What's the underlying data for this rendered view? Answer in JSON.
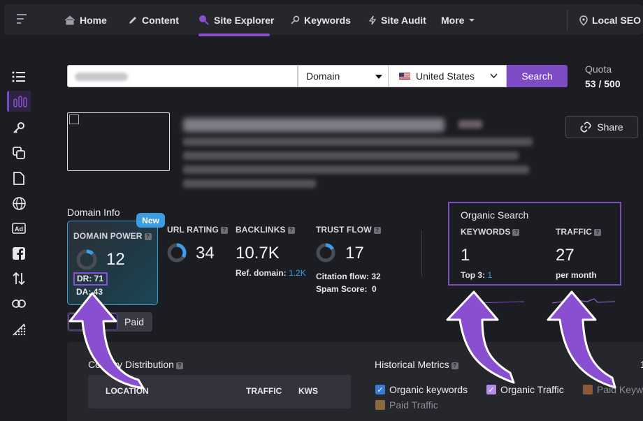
{
  "nav": {
    "items": [
      {
        "label": "Home",
        "icon": "home-icon"
      },
      {
        "label": "Content",
        "icon": "pencil-icon"
      },
      {
        "label": "Site Explorer",
        "icon": "telescope-icon"
      },
      {
        "label": "Keywords",
        "icon": "key-icon"
      },
      {
        "label": "Site Audit",
        "icon": "bolt-icon"
      },
      {
        "label": "More",
        "icon": "chevron-down-icon"
      }
    ],
    "active": "Site Explorer",
    "right_label": "Local SEO"
  },
  "sidebar": {
    "icons": [
      "list-icon",
      "bar-chart-icon",
      "key-icon",
      "copy-icon",
      "document-icon",
      "globe-icon",
      "ad-icon",
      "facebook-icon",
      "sort-arrows-icon",
      "link-icon",
      "dots-chart-icon"
    ],
    "active_index": 1
  },
  "search": {
    "mode": "Domain",
    "country": "United States",
    "button": "Search",
    "quota_label": "Quota",
    "quota_value": "53 / 500"
  },
  "site": {
    "share_label": "Share"
  },
  "domain_info": {
    "title": "Domain Info",
    "domain_power": {
      "label": "DOMAIN POWER",
      "badge": "New",
      "value": "12",
      "dr": "DR: 71",
      "da": "DA: 43",
      "fill_fraction": 0.12
    },
    "url_rating": {
      "label": "URL RATING",
      "value": "34",
      "fill_fraction": 0.34
    },
    "backlinks": {
      "label": "BACKLINKS",
      "value": "10.7K",
      "ref_label": "Ref. domain:",
      "ref_value": "1.2K"
    },
    "trust_flow": {
      "label": "TRUST FLOW",
      "value": "17",
      "citation": "Citation flow: 32",
      "spam": "Spam Score:  0",
      "fill_fraction": 0.17
    }
  },
  "organic": {
    "title": "Organic Search",
    "keywords_label": "KEYWORDS",
    "keywords_value": "1",
    "top3_label": "Top 3:",
    "top3_value": "1",
    "traffic_label": "TRAFFIC",
    "traffic_value": "27",
    "traffic_sub": "per month"
  },
  "toggle": {
    "right": "Paid"
  },
  "country_dist": {
    "title": "Country Distribution",
    "columns": [
      "LOCATION",
      "TRAFFIC",
      "KWS"
    ]
  },
  "historical": {
    "title": "Historical Metrics",
    "legend": [
      {
        "label": "Organic keywords",
        "color": "#3a7bd5",
        "checked": true
      },
      {
        "label": "Organic Traffic",
        "color": "#b48de8",
        "checked": true
      },
      {
        "label": "Paid Keyw",
        "color": "#8a5a3c",
        "checked": false
      },
      {
        "label": "Paid Traffic",
        "color": "#8a6a3c",
        "checked": false
      }
    ],
    "edge_text": "1"
  },
  "colors": {
    "accent": "#7d4bc4",
    "link": "#3a9fe8",
    "badge": "#3b9ce2"
  }
}
